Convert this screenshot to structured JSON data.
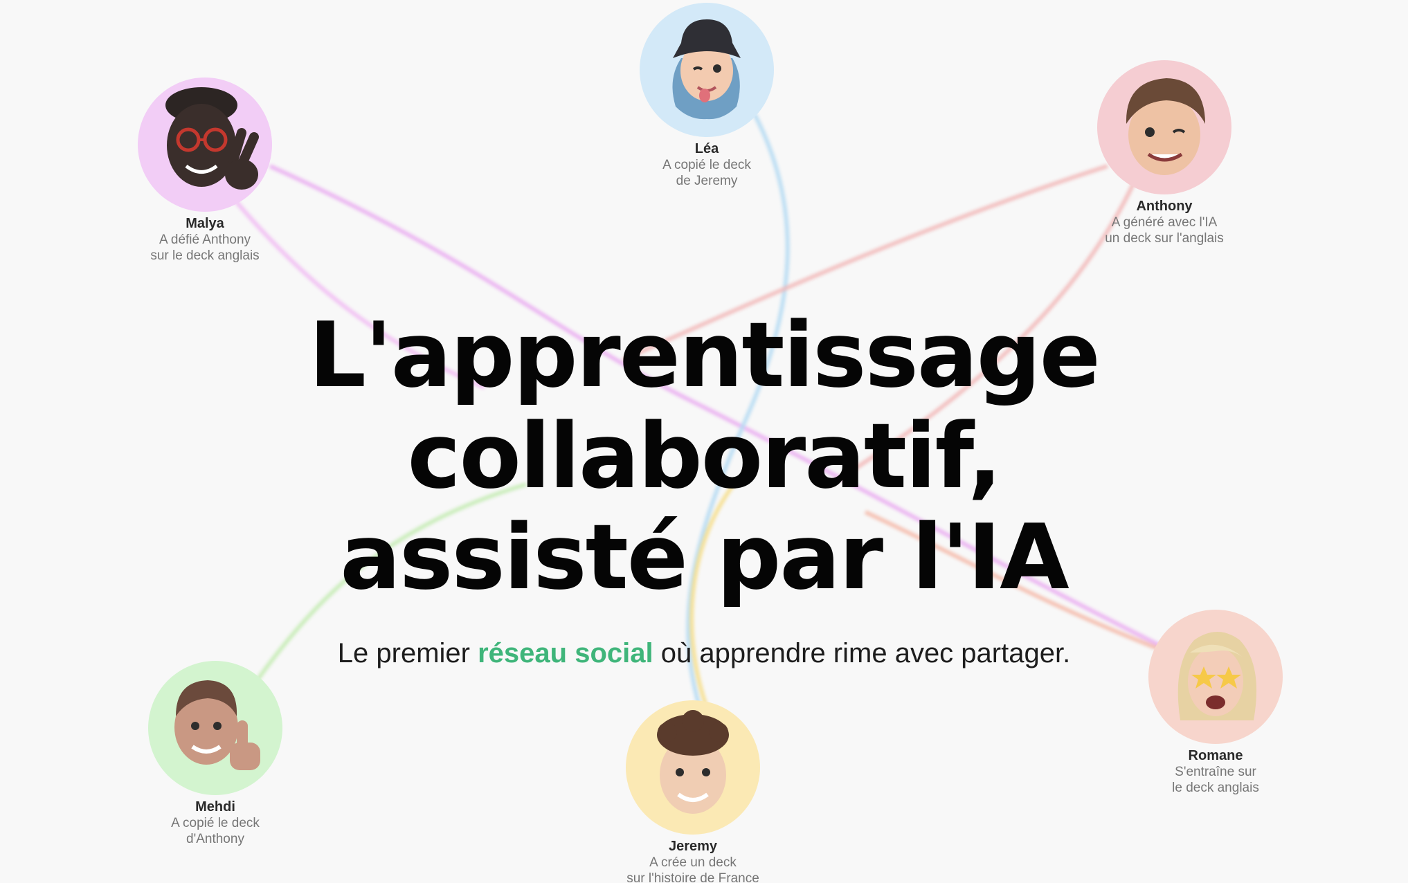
{
  "hero": {
    "headline_line1": "L'apprentissage collaboratif,",
    "headline_line2": "assisté par l'IA",
    "tagline_before": "Le premier ",
    "tagline_highlight": "réseau social",
    "tagline_after": " où apprendre rime avec partager.",
    "accent_color": "#3fb57a"
  },
  "users": [
    {
      "id": "malya",
      "name": "Malya",
      "action_line1": "A défié Anthony",
      "action_line2": "sur le deck anglais",
      "avatar_bg": "#f2cdf6",
      "icon": "memoji-glasses-peace-icon"
    },
    {
      "id": "lea",
      "name": "Léa",
      "action_line1": "A copié le deck",
      "action_line2": "de Jeremy",
      "avatar_bg": "#d3e9f8",
      "icon": "memoji-bucket-hat-icon"
    },
    {
      "id": "anthony",
      "name": "Anthony",
      "action_line1": "A généré avec l'IA",
      "action_line2": "un deck sur l'anglais",
      "avatar_bg": "#f5cdd2",
      "icon": "memoji-wink-icon"
    },
    {
      "id": "mehdi",
      "name": "Mehdi",
      "action_line1": "A copié le deck",
      "action_line2": "d'Anthony",
      "avatar_bg": "#d3f4cf",
      "icon": "memoji-thumbs-up-icon"
    },
    {
      "id": "jeremy",
      "name": "Jeremy",
      "action_line1": "A crée un deck",
      "action_line2": "sur l'histoire de France",
      "avatar_bg": "#fbe9b4",
      "icon": "memoji-curly-hair-icon"
    },
    {
      "id": "romane",
      "name": "Romane",
      "action_line1": "S'entraîne sur",
      "action_line2": "le deck anglais",
      "avatar_bg": "#f7d5cc",
      "icon": "memoji-star-eyes-icon"
    }
  ],
  "connection_colors": {
    "pink": "#e9a6f0",
    "blue": "#b7dcf3",
    "red": "#f1b3b3",
    "green": "#c6ecb6",
    "yellow": "#f6df8f",
    "salmon": "#f4b8a8"
  }
}
